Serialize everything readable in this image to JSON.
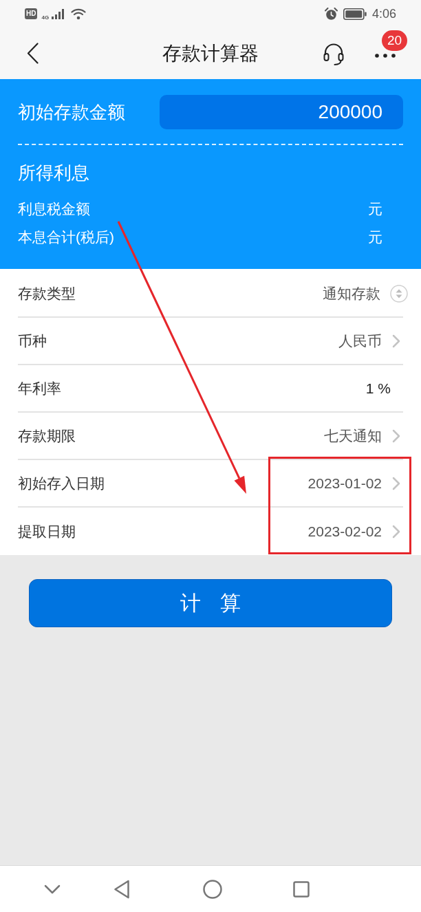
{
  "status_bar": {
    "hd_label": "HD",
    "network_label": "4G",
    "time": "4:06"
  },
  "header": {
    "title": "存款计算器",
    "more_badge": "20"
  },
  "summary": {
    "amount_label": "初始存款金额",
    "amount_value": "200000",
    "interest_title": "所得利息",
    "results": [
      {
        "label": "利息税金额",
        "unit": "元"
      },
      {
        "label": "本息合计(税后)",
        "unit": "元"
      }
    ]
  },
  "form_rows": [
    {
      "kind": "select",
      "label": "存款类型",
      "value": "通知存款"
    },
    {
      "kind": "picker",
      "label": "币种",
      "value": "人民币"
    },
    {
      "kind": "input",
      "label": "年利率",
      "value": "1",
      "unit": "%"
    },
    {
      "kind": "picker",
      "label": "存款期限",
      "value": "七天通知"
    },
    {
      "kind": "picker",
      "label": "初始存入日期",
      "value": "2023-01-02"
    },
    {
      "kind": "picker",
      "label": "提取日期",
      "value": "2023-02-02"
    }
  ],
  "calculate_button": "计 算",
  "annotations": {
    "arrow": true,
    "highlight_frame": true
  }
}
